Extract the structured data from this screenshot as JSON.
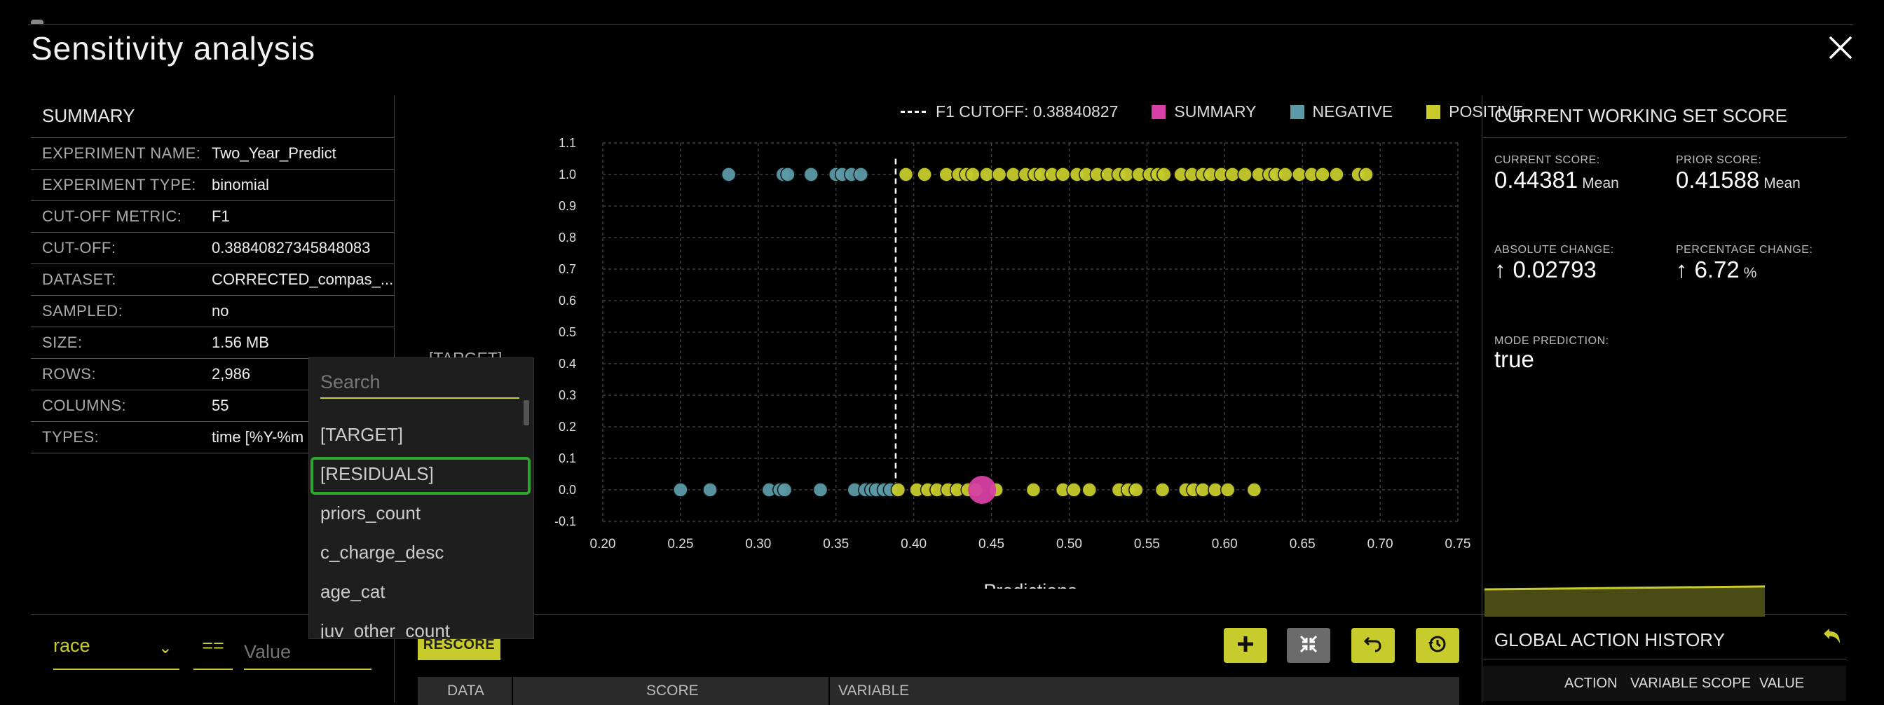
{
  "page": {
    "title": "Sensitivity analysis"
  },
  "summary": {
    "title": "SUMMARY",
    "rows": [
      {
        "key": "EXPERIMENT NAME:",
        "value": "Two_Year_Predict"
      },
      {
        "key": "EXPERIMENT TYPE:",
        "value": "binomial"
      },
      {
        "key": "CUT-OFF METRIC:",
        "value": "F1"
      },
      {
        "key": "CUT-OFF:",
        "value": "0.38840827345848083"
      },
      {
        "key": "DATASET:",
        "value": "CORRECTED_compas_..."
      },
      {
        "key": "SAMPLED:",
        "value": "no"
      },
      {
        "key": "SIZE:",
        "value": "1.56 MB"
      },
      {
        "key": "ROWS:",
        "value": "2,986"
      },
      {
        "key": "COLUMNS:",
        "value": "55"
      },
      {
        "key": "TYPES:",
        "value": "time [%Y-%m"
      }
    ]
  },
  "legend": {
    "cutoff": "F1 CUTOFF: 0.38840827",
    "summary": "SUMMARY",
    "negative": "NEGATIVE",
    "positive": "POSITIVE"
  },
  "colors": {
    "negative": "#5b9aa6",
    "positive": "#c7cc2c",
    "summary": "#d63fa3",
    "accent": "#c7cc2c",
    "highlight": "#2ea52e"
  },
  "y_select": {
    "label": "[TARGET]"
  },
  "dropdown": {
    "placeholder": "Search",
    "items": [
      "[TARGET]",
      "[RESIDUALS]",
      "priors_count",
      "c_charge_desc",
      "age_cat",
      "juv_other_count"
    ],
    "highlighted": "[RESIDUALS]"
  },
  "score": {
    "title": "CURRENT WORKING SET SCORE",
    "current_label": "CURRENT SCORE:",
    "current_value": "0.44381",
    "current_unit": "Mean",
    "prior_label": "PRIOR SCORE:",
    "prior_value": "0.41588",
    "prior_unit": "Mean",
    "abs_label": "ABSOLUTE CHANGE:",
    "abs_value": "0.02793",
    "pct_label": "PERCENTAGE CHANGE:",
    "pct_value": "6.72",
    "pct_unit": "%",
    "mode_label": "MODE PREDICTION:",
    "mode_value": "true"
  },
  "score_chart": {
    "values": [
      0.43,
      0.44381
    ]
  },
  "filter": {
    "column": "race",
    "operator": "==",
    "value_placeholder": "Value"
  },
  "toolbar": {
    "rescore": "RESCORE"
  },
  "table": {
    "headers": [
      "DATA",
      "SCORE",
      "VARIABLE"
    ]
  },
  "history": {
    "title": "GLOBAL ACTION HISTORY",
    "headers": [
      "ACTION",
      "VARIABLE SCOPE",
      "VALUE"
    ]
  },
  "chart_data": {
    "type": "scatter",
    "xlabel": "Predictions",
    "ylabel": "",
    "xlim": [
      0.2,
      0.75
    ],
    "ylim": [
      -0.1,
      1.1
    ],
    "x_ticks": [
      "0.20",
      "0.25",
      "0.30",
      "0.35",
      "0.40",
      "0.45",
      "0.50",
      "0.55",
      "0.60",
      "0.65",
      "0.70",
      "0.75"
    ],
    "y_ticks": [
      "1.1",
      "1.0",
      "0.9",
      "0.8",
      "0.7",
      "0.6",
      "0.5",
      "0.4",
      "0.3",
      "0.2",
      "0.1",
      "0.0",
      "-0.1"
    ],
    "grid": true,
    "legend_position": "top-right",
    "cutoff": 0.3884,
    "series": [
      {
        "name": "NEGATIVE",
        "points": [
          [
            0.281,
            1
          ],
          [
            0.316,
            1
          ],
          [
            0.319,
            1
          ],
          [
            0.334,
            1
          ],
          [
            0.35,
            1
          ],
          [
            0.354,
            1
          ],
          [
            0.36,
            1
          ],
          [
            0.366,
            1
          ],
          [
            0.25,
            0
          ],
          [
            0.269,
            0
          ],
          [
            0.307,
            0
          ],
          [
            0.314,
            0
          ],
          [
            0.317,
            0
          ],
          [
            0.34,
            0
          ],
          [
            0.362,
            0
          ],
          [
            0.369,
            0
          ],
          [
            0.373,
            0
          ],
          [
            0.376,
            0
          ],
          [
            0.381,
            0
          ],
          [
            0.385,
            0
          ]
        ]
      },
      {
        "name": "POSITIVE",
        "points": [
          [
            0.395,
            1
          ],
          [
            0.407,
            1
          ],
          [
            0.421,
            1
          ],
          [
            0.429,
            1
          ],
          [
            0.434,
            1
          ],
          [
            0.438,
            1
          ],
          [
            0.447,
            1
          ],
          [
            0.455,
            1
          ],
          [
            0.464,
            1
          ],
          [
            0.472,
            1
          ],
          [
            0.478,
            1
          ],
          [
            0.482,
            1
          ],
          [
            0.489,
            1
          ],
          [
            0.496,
            1
          ],
          [
            0.505,
            1
          ],
          [
            0.511,
            1
          ],
          [
            0.518,
            1
          ],
          [
            0.525,
            1
          ],
          [
            0.532,
            1
          ],
          [
            0.537,
            1
          ],
          [
            0.545,
            1
          ],
          [
            0.552,
            1
          ],
          [
            0.557,
            1
          ],
          [
            0.561,
            1
          ],
          [
            0.572,
            1
          ],
          [
            0.579,
            1
          ],
          [
            0.586,
            1
          ],
          [
            0.591,
            1
          ],
          [
            0.598,
            1
          ],
          [
            0.605,
            1
          ],
          [
            0.613,
            1
          ],
          [
            0.622,
            1
          ],
          [
            0.629,
            1
          ],
          [
            0.633,
            1
          ],
          [
            0.639,
            1
          ],
          [
            0.648,
            1
          ],
          [
            0.656,
            1
          ],
          [
            0.663,
            1
          ],
          [
            0.672,
            1
          ],
          [
            0.686,
            1
          ],
          [
            0.691,
            1
          ],
          [
            0.39,
            0
          ],
          [
            0.402,
            0
          ],
          [
            0.409,
            0
          ],
          [
            0.415,
            0
          ],
          [
            0.422,
            0
          ],
          [
            0.428,
            0
          ],
          [
            0.435,
            0
          ],
          [
            0.44,
            0
          ],
          [
            0.453,
            0
          ],
          [
            0.477,
            0
          ],
          [
            0.496,
            0
          ],
          [
            0.503,
            0
          ],
          [
            0.513,
            0
          ],
          [
            0.532,
            0
          ],
          [
            0.538,
            0
          ],
          [
            0.543,
            0
          ],
          [
            0.56,
            0
          ],
          [
            0.575,
            0
          ],
          [
            0.58,
            0
          ],
          [
            0.586,
            0
          ],
          [
            0.594,
            0
          ],
          [
            0.602,
            0
          ],
          [
            0.619,
            0
          ]
        ]
      },
      {
        "name": "SUMMARY",
        "points": [
          [
            0.444,
            0
          ]
        ]
      }
    ]
  }
}
